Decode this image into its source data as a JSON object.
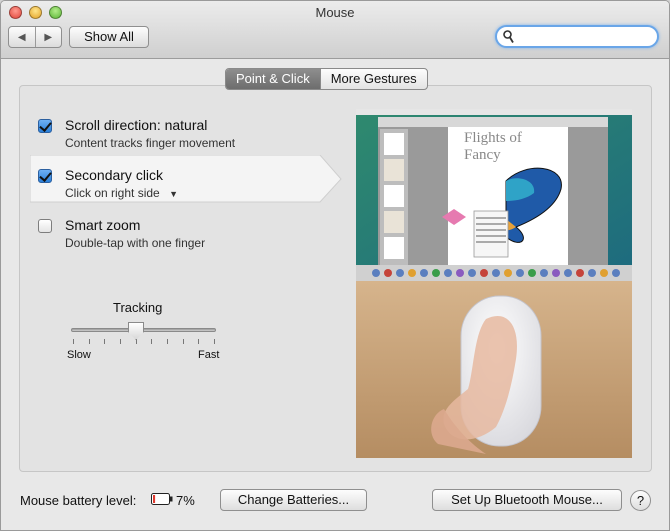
{
  "window": {
    "title": "Mouse"
  },
  "toolbar": {
    "back_glyph": "◀",
    "forward_glyph": "▶",
    "show_all_label": "Show All",
    "search_value": "",
    "search_placeholder": ""
  },
  "tabs": [
    {
      "label": "Point & Click",
      "active": true
    },
    {
      "label": "More Gestures",
      "active": false
    }
  ],
  "options": [
    {
      "title": "Scroll direction: natural",
      "subtitle": "Content tracks finger movement",
      "checked": true
    },
    {
      "title": "Secondary click",
      "subtitle": "Click on right side",
      "checked": true,
      "selected": true,
      "dropdown": true
    },
    {
      "title": "Smart zoom",
      "subtitle": "Double-tap with one finger",
      "checked": false
    }
  ],
  "tracking": {
    "label": "Tracking",
    "min_label": "Slow",
    "max_label": "Fast",
    "value": 0.45,
    "tick_count": 10
  },
  "preview": {
    "doc_title_line1": "Flights of",
    "doc_title_line2": "Fancy"
  },
  "footer": {
    "battery_label": "Mouse battery level:",
    "battery_percent": "7%",
    "battery_level": 0.07,
    "change_batteries_label": "Change Batteries...",
    "bluetooth_label": "Set Up Bluetooth Mouse...",
    "help_label": "?"
  },
  "colors": {
    "accent": "#2a7fd8",
    "battery_low": "#e03a30"
  }
}
